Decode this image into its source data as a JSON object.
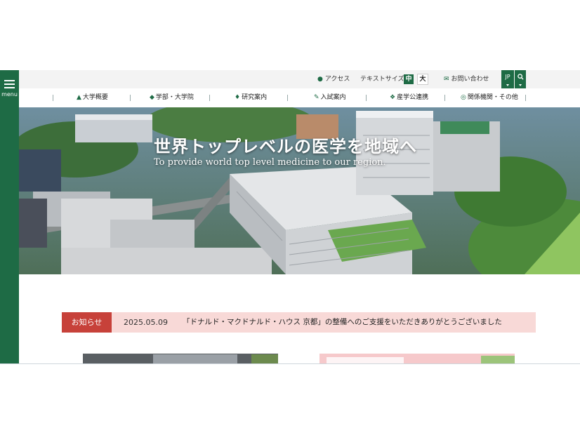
{
  "menu": {
    "label": "menu"
  },
  "utility": {
    "access": "アクセス",
    "text_size_label": "テキストサイズ",
    "size_medium": "中",
    "size_large": "大",
    "contact": "お問い合わせ",
    "lang": "JP"
  },
  "nav": [
    {
      "label": "大学概要",
      "icon": "building-icon"
    },
    {
      "label": "学部・大学院",
      "icon": "graduation-cap-icon"
    },
    {
      "label": "研究案内",
      "icon": "flask-icon"
    },
    {
      "label": "入試案内",
      "icon": "pencil-icon"
    },
    {
      "label": "産学公連携",
      "icon": "handshake-icon"
    },
    {
      "label": "関係機関・その他",
      "icon": "globe-icon"
    }
  ],
  "hero": {
    "title": "世界トップレベルの医学を地域へ",
    "subtitle": "To provide world top level medicine to our region."
  },
  "news": {
    "label": "お知らせ",
    "date": "2025.05.09",
    "text": "「ドナルド・マクドナルド・ハウス 京都」の整備へのご支援をいただきありがとうございました"
  },
  "colors": {
    "brand_green": "#1e6b45",
    "news_red": "#c7413a",
    "news_bg": "#f8d9d7"
  }
}
